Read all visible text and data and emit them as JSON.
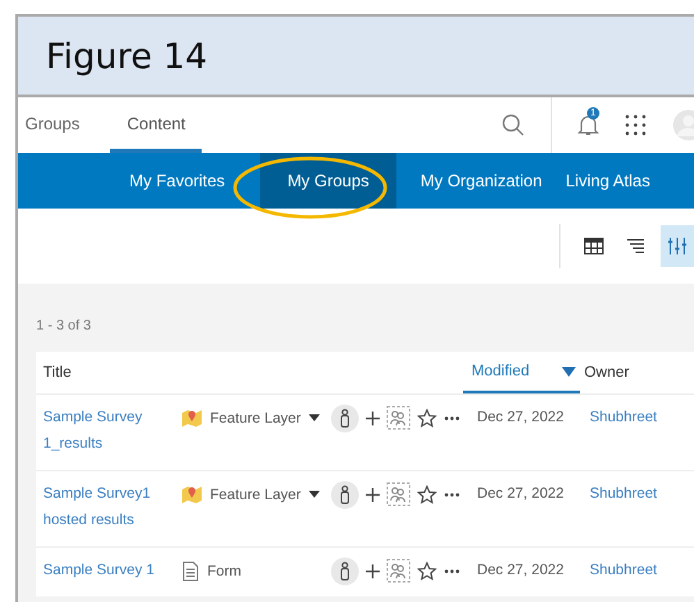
{
  "figure_title": "Figure 14",
  "nav_tabs": [
    {
      "label": "Groups",
      "selected": false
    },
    {
      "label": "Content",
      "selected": true
    }
  ],
  "notifications": {
    "count": "1"
  },
  "sub_tabs": [
    {
      "label": "My Favorites",
      "selected": false
    },
    {
      "label": "My Groups",
      "selected": true
    },
    {
      "label": "My Organization",
      "selected": false
    },
    {
      "label": "Living Atlas",
      "selected": false
    }
  ],
  "toolbar": [
    {
      "kind": "table",
      "selected": false
    },
    {
      "kind": "sort",
      "selected": false
    },
    {
      "kind": "filter",
      "selected": true
    }
  ],
  "result_count": "1 - 3 of 3",
  "table": {
    "columns": [
      {
        "label": "Title",
        "sorted": false
      },
      {
        "label": "Modified",
        "sorted": true
      },
      {
        "label": "Owner",
        "sorted": false
      }
    ],
    "rows": [
      {
        "title": "Sample Survey 1_results",
        "kind": "layer",
        "type": "Feature Layer",
        "dropdown": true,
        "modified": "Dec 27, 2022",
        "owner": "Shubhreet"
      },
      {
        "title": "Sample Survey1 hosted results",
        "kind": "layer",
        "type": "Feature Layer",
        "dropdown": true,
        "modified": "Dec 27, 2022",
        "owner": "Shubhreet"
      },
      {
        "title": "Sample Survey 1",
        "kind": "form",
        "type": "Form",
        "dropdown": false,
        "modified": "Dec 27, 2022",
        "owner": "Shubhreet"
      }
    ]
  }
}
